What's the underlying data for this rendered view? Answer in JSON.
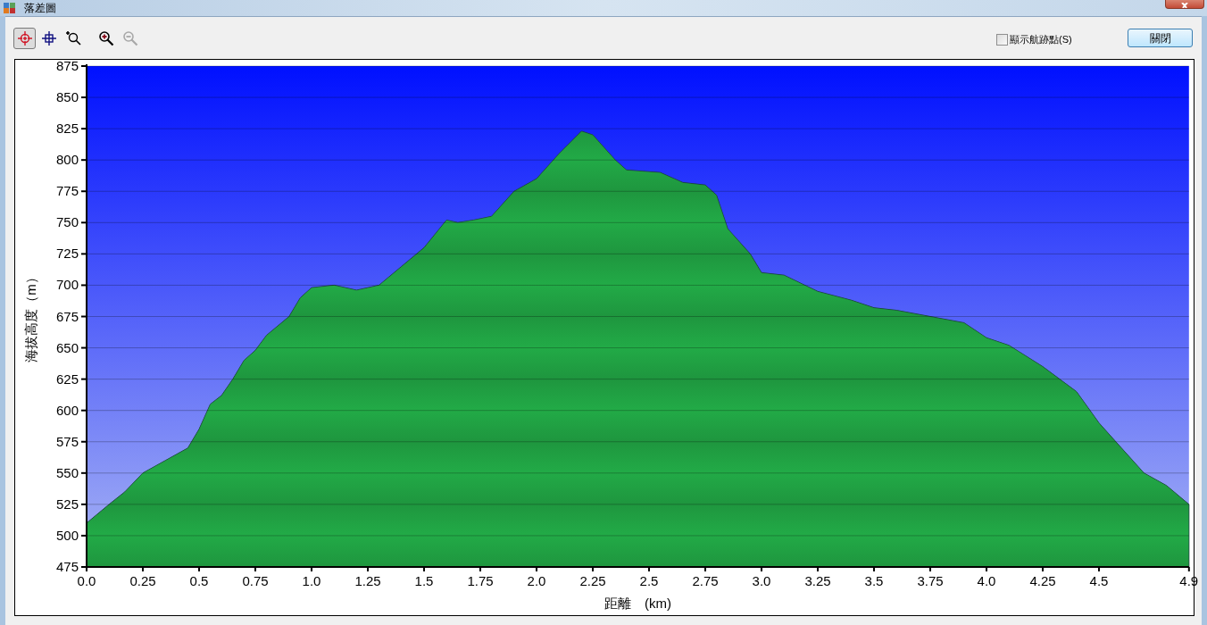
{
  "window": {
    "title": "落差圖"
  },
  "toolbar": {
    "tools": [
      {
        "kind": "pointer",
        "selected": true,
        "disabled": false
      },
      {
        "kind": "crosshair",
        "selected": false,
        "disabled": false
      },
      {
        "kind": "zoom-area",
        "selected": false,
        "disabled": false
      },
      {
        "kind": "zoom-in",
        "selected": false,
        "disabled": false
      },
      {
        "kind": "zoom-out",
        "selected": false,
        "disabled": true
      }
    ]
  },
  "show_track_points": {
    "label": "顯示航跡點(S)",
    "checked": false
  },
  "close_button": {
    "label": "關閉"
  },
  "chart": {
    "chart_data": {
      "type": "area",
      "xlabel": "距離　(km)",
      "ylabel": "海拔高度（m）",
      "x": [
        0,
        0.1,
        0.17,
        0.25,
        0.35,
        0.45,
        0.5,
        0.55,
        0.6,
        0.65,
        0.7,
        0.75,
        0.8,
        0.9,
        0.95,
        1.0,
        1.1,
        1.2,
        1.3,
        1.4,
        1.5,
        1.6,
        1.65,
        1.72,
        1.8,
        1.9,
        2.0,
        2.1,
        2.2,
        2.25,
        2.35,
        2.4,
        2.55,
        2.65,
        2.75,
        2.8,
        2.85,
        2.95,
        3.0,
        3.1,
        3.25,
        3.4,
        3.5,
        3.6,
        3.75,
        3.9,
        4.0,
        4.1,
        4.25,
        4.4,
        4.5,
        4.6,
        4.7,
        4.8,
        4.9
      ],
      "series": [
        {
          "color": "#22a845",
          "values": [
            510,
            525,
            535,
            550,
            560,
            570,
            585,
            605,
            612,
            625,
            640,
            648,
            660,
            675,
            690,
            698,
            700,
            696,
            700,
            715,
            730,
            752,
            750,
            752,
            755,
            775,
            785,
            805,
            823,
            820,
            800,
            792,
            790,
            782,
            780,
            772,
            745,
            725,
            710,
            708,
            695,
            688,
            682,
            680,
            675,
            670,
            658,
            652,
            635,
            615,
            590,
            570,
            550,
            540,
            525
          ]
        }
      ],
      "grid": true,
      "xlim": [
        0,
        4.9
      ],
      "ylim": [
        475,
        875
      ],
      "xticks": [
        {
          "value": 0,
          "label": "0.0"
        },
        0.25,
        0.5,
        0.75,
        {
          "value": 1,
          "label": "1.0"
        },
        1.25,
        1.5,
        1.75,
        {
          "value": 2,
          "label": "2.0"
        },
        2.25,
        2.5,
        2.75,
        {
          "value": 3,
          "label": "3.0"
        },
        3.25,
        3.5,
        3.75,
        {
          "value": 4,
          "label": "4.0"
        },
        4.25,
        4.5,
        4.9
      ],
      "yticks": [
        475,
        500,
        525,
        550,
        575,
        600,
        625,
        650,
        675,
        700,
        725,
        750,
        775,
        800,
        825,
        850,
        875
      ]
    }
  }
}
